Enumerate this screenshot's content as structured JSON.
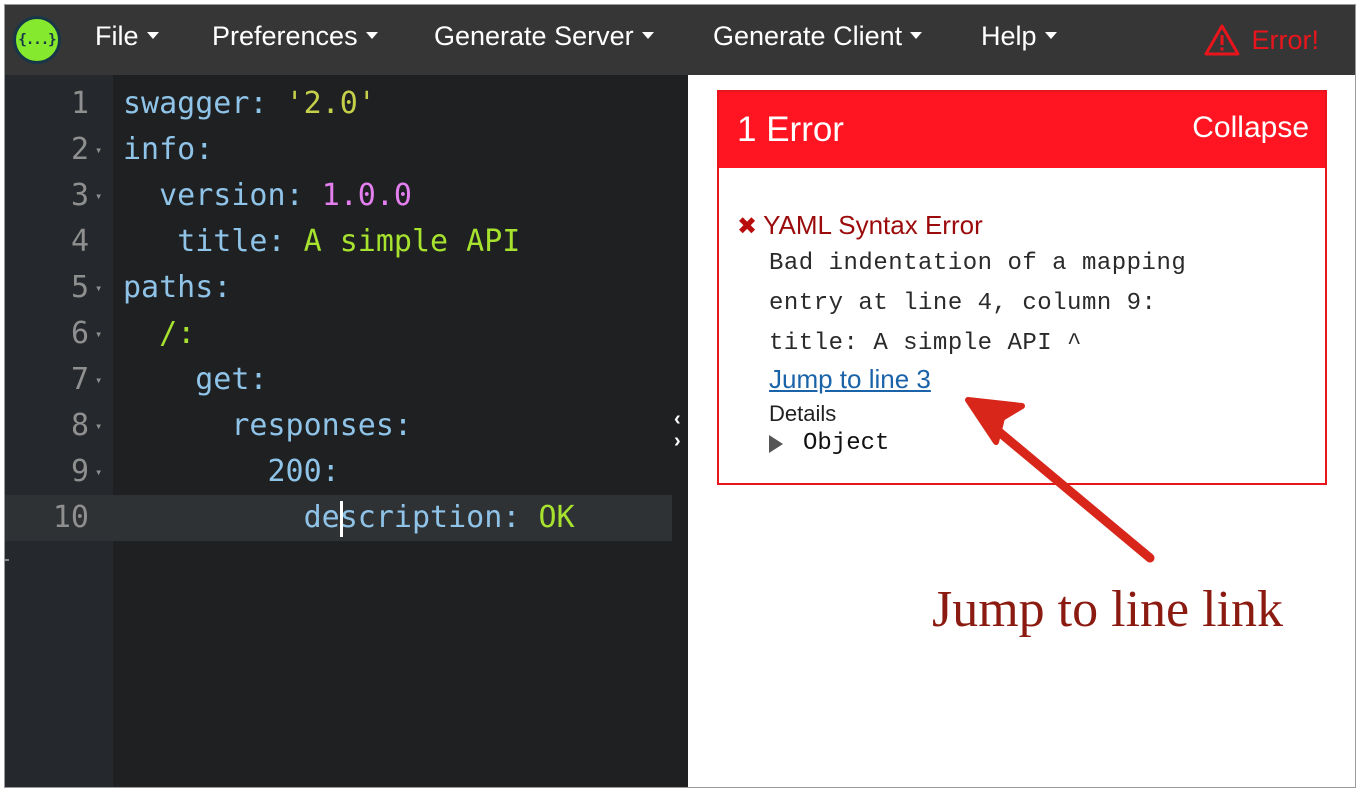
{
  "app": {
    "logo_text": "{...}"
  },
  "menu": [
    {
      "label": "File"
    },
    {
      "label": "Preferences"
    },
    {
      "label": "Generate Server"
    },
    {
      "label": "Generate Client"
    },
    {
      "label": "Help"
    }
  ],
  "status": {
    "label": "Error!"
  },
  "editor": {
    "line_numbers": [
      "1",
      "2",
      "3",
      "4",
      "5",
      "6",
      "7",
      "8",
      "9",
      "10"
    ],
    "active_line": 10,
    "lines": [
      {
        "key": "swagger",
        "value": "'2.0'"
      },
      {
        "key": "info",
        "value": ""
      },
      {
        "key": "version",
        "value": "1.0.0"
      },
      {
        "key": "title",
        "value": "A simple API"
      },
      {
        "key": "paths",
        "value": ""
      },
      {
        "key": "/",
        "value": ""
      },
      {
        "key": "get",
        "value": ""
      },
      {
        "key": "responses",
        "value": ""
      },
      {
        "key": "200",
        "value": ""
      },
      {
        "key": "description",
        "value": "OK"
      }
    ]
  },
  "error_panel": {
    "count_label": "1 Error",
    "collapse_label": "Collapse",
    "error_title": "YAML Syntax Error",
    "message_lines": [
      "Bad indentation of a mapping",
      "entry at line 4, column 9:",
      "title: A simple API ^"
    ],
    "jump_link": "Jump to line 3",
    "details_label": "Details",
    "object_label": "Object"
  },
  "annotation": {
    "text": "Jump to line link",
    "color": "#8b1a10"
  },
  "colors": {
    "error_red": "#ff1521",
    "topbar": "#363636",
    "editor_bg": "#1e2022",
    "logo_green": "#85ea2d"
  }
}
